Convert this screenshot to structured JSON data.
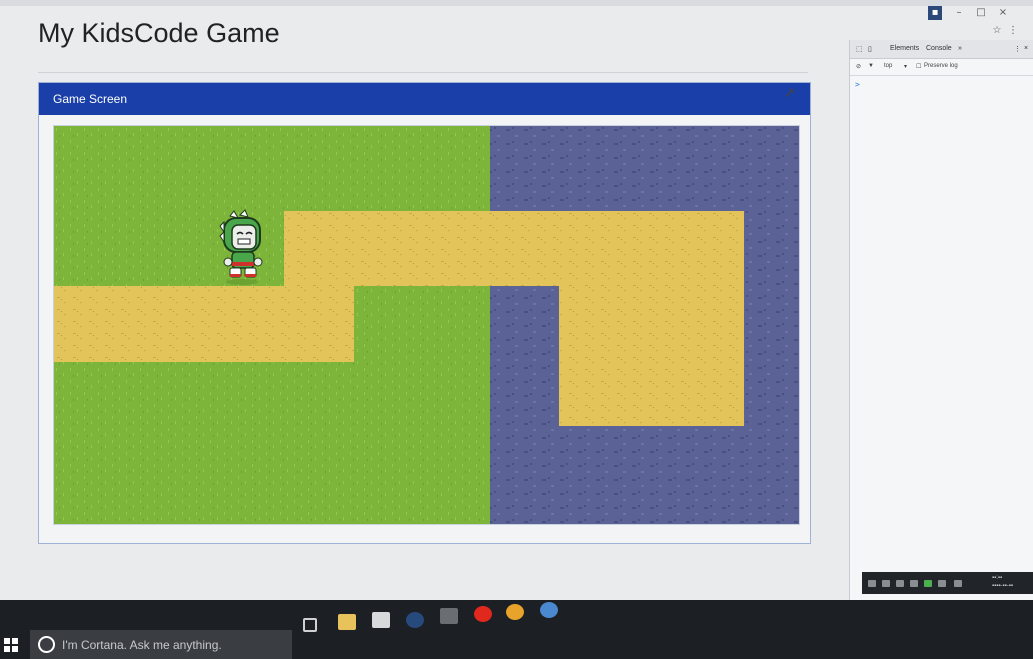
{
  "page": {
    "title": "My KidsCode Game"
  },
  "panel": {
    "header": "Game Screen",
    "header_color": "#1a3fa8"
  },
  "game": {
    "colors": {
      "grass": "#7cb53a",
      "stone": "#5b6296",
      "path": "#e2c45a"
    },
    "character": "dino-hood-kid"
  },
  "devtools": {
    "tabs": [
      "Elements",
      "Console"
    ],
    "filter": "top",
    "preserve_log": "Preserve log",
    "prompt": ">"
  },
  "taskbar": {
    "cortana_placeholder": "I'm Cortana. Ask me anything.",
    "apps": [
      "task-view",
      "file-explorer",
      "store",
      "steam",
      "app",
      "opera",
      "chrome",
      "app-blue"
    ]
  }
}
